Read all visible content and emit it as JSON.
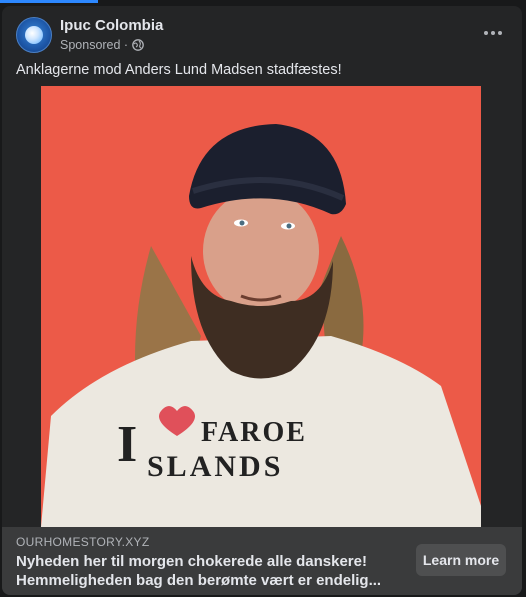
{
  "post": {
    "page_name": "Ipuc Colombia",
    "sponsored_label": "Sponsored ·",
    "text": "Anklagerne mod Anders Lund Madsen stadfæstes!",
    "image": {
      "shirt_text_line1_left": "I",
      "shirt_text_line1_right": "FAROE",
      "shirt_text_line2": "SLANDS",
      "background_color": "#ec5a48",
      "heart_color": "#e0505a"
    }
  },
  "link_preview": {
    "domain": "OURHOMESTORY.XYZ",
    "headline_line1": "Nyheden her til morgen chokerede alle danskere!",
    "headline_line2": "Hemmeligheden bag den berømte vært er endelig...",
    "cta_label": "Learn more"
  },
  "icons": {
    "avatar": "ipuc-colombia-logo",
    "privacy": "globe-icon",
    "options": "more-options-icon"
  },
  "colors": {
    "background": "#18191a",
    "card": "#242526",
    "link_bar": "#3a3b3c",
    "button": "#4e4f50",
    "accent": "#2d88ff"
  }
}
